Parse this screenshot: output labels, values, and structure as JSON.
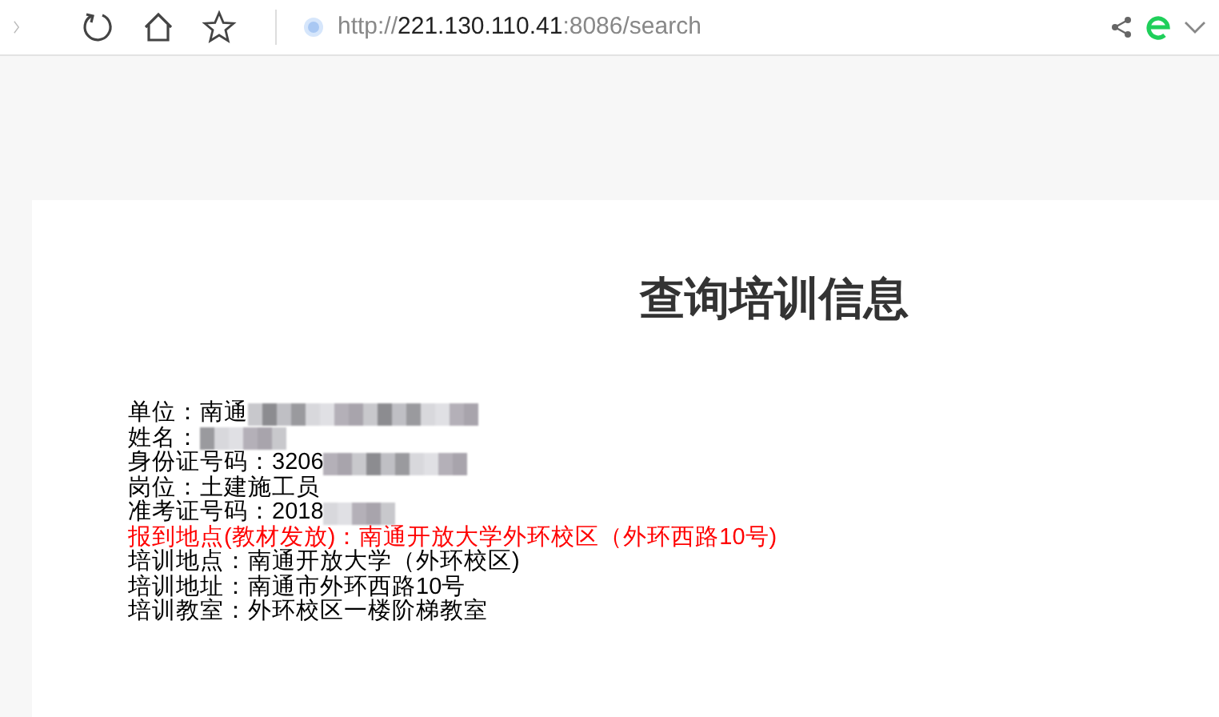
{
  "address_bar": {
    "url_parts": [
      {
        "text": "http://",
        "emphasis": false
      },
      {
        "text": "221.130.110.41",
        "emphasis": true
      },
      {
        "text": ":8086/search",
        "emphasis": false
      }
    ]
  },
  "page": {
    "title": "查询培训信息",
    "lines": [
      {
        "text": "单位：南通",
        "redacted": true,
        "color": "#000000"
      },
      {
        "text": "姓名：",
        "redacted": true,
        "color": "#000000"
      },
      {
        "text": "身份证号码：3206",
        "redacted": true,
        "color": "#000000"
      },
      {
        "text": "岗位：土建施工员",
        "redacted": false,
        "color": "#000000"
      },
      {
        "text": "准考证号码：2018",
        "redacted": true,
        "color": "#000000"
      },
      {
        "text": "报到地点(教材发放)：南通开放大学外环校区（外环西路10号)",
        "redacted": false,
        "color": "#ff0000"
      },
      {
        "text": "培训地点：南通开放大学（外环校区)",
        "redacted": false,
        "color": "#000000"
      },
      {
        "text": "培训地址：南通市外环西路10号",
        "redacted": false,
        "color": "#000000"
      },
      {
        "text": "培训教室：外环校区一楼阶梯教室",
        "redacted": false,
        "color": "#000000"
      }
    ]
  }
}
